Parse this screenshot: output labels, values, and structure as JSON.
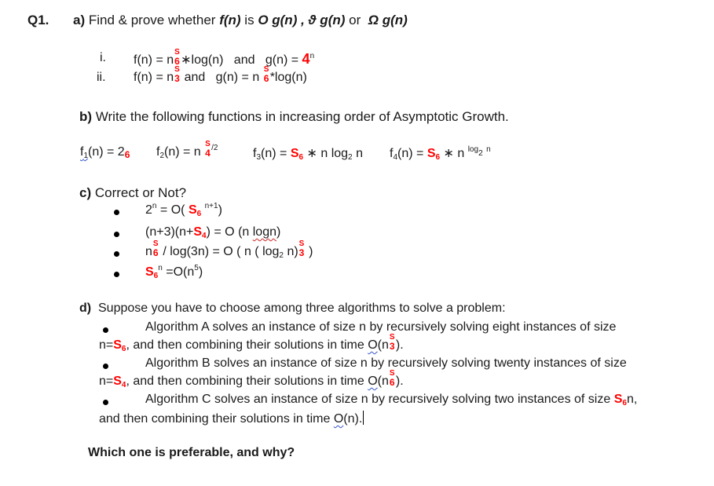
{
  "question": {
    "number": "Q1.",
    "part_a": {
      "label": "a)",
      "intro": "Find & prove whether",
      "f": "f(n)",
      "is": "is",
      "big_o": "O g(n) ,",
      "theta": "ϑ g(n)",
      "or": "or",
      "omega": "Ω g(n)",
      "items": [
        {
          "marker": "i.",
          "f_prefix": "f(n) = n",
          "f_sup": "S",
          "f_sub": "6",
          "f_suffix": "∗log(n)",
          "and": "and",
          "g_prefix": "g(n) =",
          "g_base": "4",
          "g_sup": "n"
        },
        {
          "marker": "ii.",
          "f_prefix": "f(n) = n",
          "f_sup": "S",
          "f_sub": "3",
          "and": "and",
          "g_prefix": "g(n) = n",
          "g_sup": "S",
          "g_sub": "6",
          "g_suffix": "*log(n)"
        }
      ]
    },
    "part_b": {
      "label": "b)",
      "text": "Write the following functions in increasing order of Asymptotic Growth.",
      "functions": [
        {
          "name": "f",
          "index": "1",
          "expr_prefix": "(n) = 2",
          "red_sub": "6"
        },
        {
          "name": "f",
          "index": "2",
          "expr_prefix": "(n) = n",
          "sup": "S",
          "sub": "4",
          "sup_suffix": "/2"
        },
        {
          "name": "f",
          "index": "3",
          "expr_prefix": "(n) =",
          "red": "S",
          "red_sub": "6",
          "expr_suffix": "∗ n log",
          "log_sub": "2",
          "tail": "n"
        },
        {
          "name": "f",
          "index": "4",
          "expr_prefix": "(n) =",
          "red": "S",
          "red_sub": "6",
          "expr_suffix": "∗ n",
          "exp_log": "log",
          "exp_sub": "2",
          "exp_n": "n"
        }
      ]
    },
    "part_c": {
      "label": "c)",
      "text": "Correct or Not?",
      "items": [
        {
          "prefix": "2",
          "prefix_sup": "n",
          "mid": "= O(",
          "red": "S",
          "red_sub": "6",
          "sup": "n+1",
          "suffix": ")"
        },
        {
          "prefix": "(n+3)(n+",
          "red": "S",
          "red_sub": "4",
          "mid": ") = O (n",
          "squiggle": "logn",
          "suffix": ")"
        },
        {
          "prefix": "n",
          "sup": "S",
          "sub": "6",
          "mid": "/ log(3n) = O ( n ( log",
          "log_sub": "2",
          "mid2": "n)",
          "sup2": "S",
          "sub2": "3",
          "suffix": ")"
        },
        {
          "red": "S",
          "red_sub": "6",
          "sup": "n",
          "mid": "=O(n",
          "sup2": "5",
          "suffix": ")"
        }
      ]
    },
    "part_d": {
      "label": "d)",
      "text": "Suppose you have to choose among three algorithms to solve a problem:",
      "algorithms": [
        {
          "line1": "Algorithm A solves an instance of size n by recursively solving eight instances of size",
          "line2_prefix": "n=",
          "red": "S",
          "red_sub": "6",
          "line2_mid": ", and then combining their solutions in time",
          "o": "O",
          "o_rest": "(n",
          "sup": "S",
          "sub": "3",
          "end": ")."
        },
        {
          "line1": "Algorithm B solves an instance of size n by recursively solving twenty instances of size",
          "line2_prefix": "n=",
          "red": "S",
          "red_sub": "4",
          "line2_mid": ", and then combining their solutions in time",
          "o": "O",
          "o_rest": "(n",
          "sup": "S",
          "sub": "6",
          "end": ")."
        },
        {
          "line1": "Algorithm C solves an instance of size n by recursively solving two instances of size",
          "line1_red": "S",
          "line1_red_sub": "6",
          "line1_end": "n,",
          "line2_mid": "and then combining their solutions in time",
          "o": "O",
          "o_rest": "(n)."
        }
      ],
      "question": "Which one is preferable, and why?"
    }
  },
  "colors": {
    "accent_red": "#ff0000",
    "text": "#1a1a1a"
  }
}
